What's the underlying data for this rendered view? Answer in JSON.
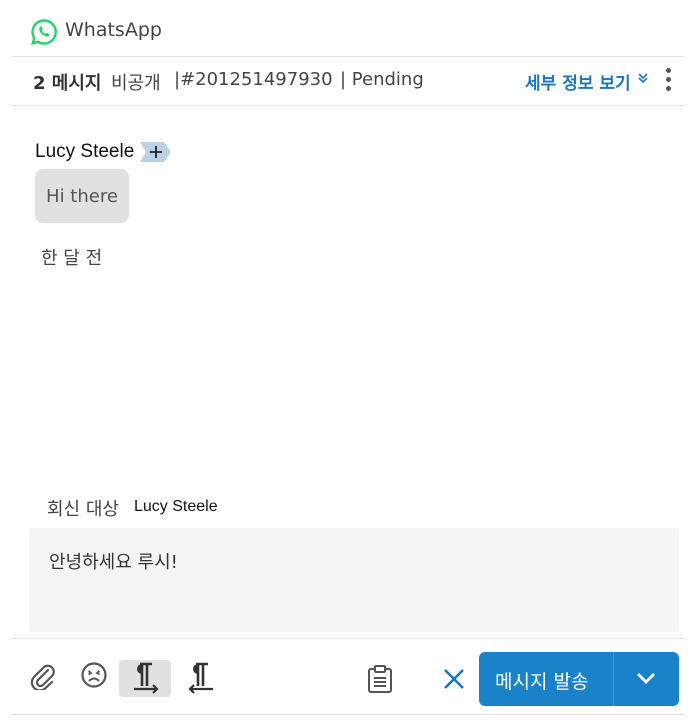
{
  "channel": {
    "name": "WhatsApp",
    "icon": "whatsapp-icon",
    "brand_color": "#25D366"
  },
  "meta": {
    "message_count": "2 메시지",
    "visibility": "비공개",
    "ticket_id": "|#201251497930",
    "status": "| Pending",
    "details_link": "세부 정보 보기",
    "link_color": "#1a76bd"
  },
  "conversation": {
    "sender": "Lucy Steele",
    "message": "Hi there",
    "timestamp": "한 달 전"
  },
  "reply": {
    "label": "회신 대상",
    "recipient": "Lucy Steele",
    "draft": "안녕하세요 루시!"
  },
  "toolbar": {
    "icons": [
      "paperclip-icon",
      "emoji-icon",
      "ltr-paragraph-icon",
      "rtl-paragraph-icon",
      "template-icon",
      "close-icon"
    ],
    "send_label": "메시지 발송",
    "send_color": "#1a82c8"
  }
}
